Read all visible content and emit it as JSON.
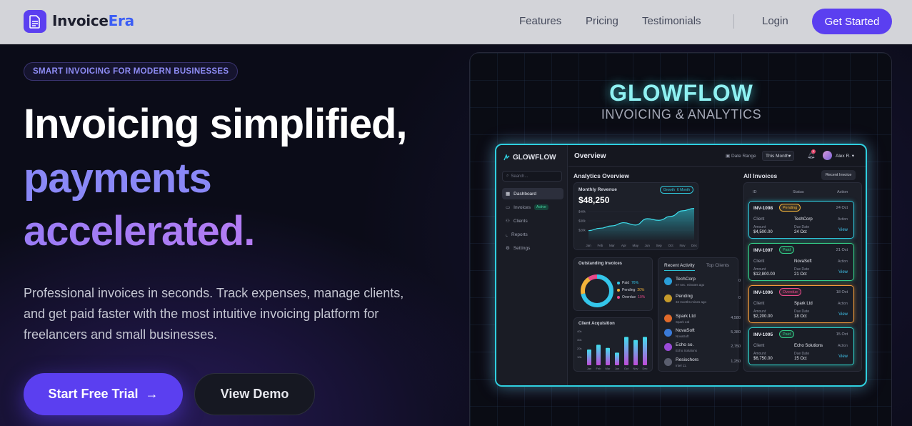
{
  "nav": {
    "brand_main": "Invoice",
    "brand_accent": "Era",
    "links": [
      "Features",
      "Pricing",
      "Testimonials"
    ],
    "login": "Login",
    "cta": "Get Started"
  },
  "hero": {
    "badge": "SMART INVOICING FOR MODERN BUSINESSES",
    "line1": "Invoicing simplified,",
    "line2": "payments",
    "line3": "accelerated.",
    "description": "Professional invoices in seconds. Track expenses, manage clients, and get paid faster with the most intuitive invoicing platform for freelancers and small businesses.",
    "primary_cta": "Start Free Trial",
    "primary_arrow": "→",
    "secondary_cta": "View Demo"
  },
  "showcase": {
    "title": "GLOWFLOW",
    "subtitle": "INVOICING & ANALYTICS",
    "dashboard": {
      "logo": "GLOWFLOW",
      "search_placeholder": "Search...",
      "sidebar": [
        "Dashboard",
        "Invoices",
        "Clients",
        "Reports",
        "Settings"
      ],
      "invoices_badge": "Active",
      "page_title": "Overview",
      "date_range_label": "Date Range",
      "date_range_value": "This Month",
      "notif_count": "3",
      "user_name": "Alex R.",
      "analytics_title": "Analytics Overview",
      "revenue": {
        "label": "Monthly Revenue",
        "value": "$48,250",
        "growth_label": "Growth",
        "period": "6 Month",
        "y_ticks": [
          "$40k",
          "$30k",
          "$20k"
        ],
        "months": [
          "Jan",
          "Feb",
          "Mar",
          "Apr",
          "May",
          "Jun",
          "Sep",
          "Oct",
          "Nov",
          "Dec"
        ],
        "values": [
          12,
          15,
          18,
          22,
          19,
          27,
          25,
          30,
          37,
          40
        ]
      },
      "outstanding": {
        "label": "Outstanding Invoices",
        "legend": [
          {
            "name": "Paid",
            "pct": "76%",
            "value": 76,
            "color": "#34c6ea"
          },
          {
            "name": "Pending",
            "pct": "20%",
            "value": 20,
            "color": "#f2b33a"
          },
          {
            "name": "Overdue",
            "pct": "10%",
            "value": 10,
            "color": "#e84a8a"
          }
        ]
      },
      "acquisition": {
        "label": "Client Acquisition",
        "y_ticks": [
          "40k",
          "30k",
          "20k",
          "10k"
        ],
        "months": [
          "Jan",
          "Feb",
          "Mar",
          "Jun",
          "Oct",
          "Nov",
          "Dec"
        ],
        "values": [
          20,
          26,
          22,
          16,
          36,
          32,
          36
        ]
      },
      "activity_tabs": [
        "Recent Activity",
        "Top Clients"
      ],
      "activity": [
        {
          "name": "TechCorp",
          "sub": "67 sec. minutes ago",
          "value": "0",
          "color": "#2a9ed8"
        },
        {
          "name": "Pending",
          "sub": "32 months mines ago",
          "value": "0",
          "color": "#c59a2a"
        },
        {
          "name": "Spark Ltd",
          "sub": "Spark Ltd",
          "value": "4,580",
          "color": "#e06a2a"
        },
        {
          "name": "NovaSoft",
          "sub": "NovaSoft",
          "value": "5,380",
          "color": "#3a7ad8"
        },
        {
          "name": "Echo so.",
          "sub": "Echo Solutions",
          "value": "2,750",
          "color": "#9a4ad8"
        },
        {
          "name": "Resischors",
          "sub": "Intel 11.",
          "value": "1,250",
          "color": "#5a5e6e"
        }
      ],
      "all_invoices_title": "All Invoices",
      "recent_btn": "Recent Invoice",
      "table_headers": [
        "ID",
        "Status",
        "Action"
      ],
      "client_label": "Client",
      "amount_label": "Amount",
      "due_label": "Due Date",
      "action_label": "Action",
      "view_label": "View",
      "invoices": [
        {
          "id": "INV-1098",
          "status": "Pending",
          "date": "24 Oct",
          "client": "TechCorp",
          "amount": "$4,500.00",
          "due": "24 Oct",
          "color": "#f2b33a",
          "border": "#2fc5d8"
        },
        {
          "id": "INV-1097",
          "status": "Paid",
          "date": "21 Oct",
          "client": "NovaSoft",
          "amount": "$12,800.00",
          "due": "21 Oct",
          "color": "#34d08a",
          "border": "#34d08a"
        },
        {
          "id": "INV-1096",
          "status": "Overdue",
          "date": "18 Oct",
          "client": "Spark Ltd",
          "amount": "$2,200.00",
          "due": "18 Oct",
          "color": "#e84a8a",
          "border": "#f29a3a"
        },
        {
          "id": "INV-1095",
          "status": "Paid",
          "date": "15 Oct",
          "client": "Echo Solutions",
          "amount": "$6,750.00",
          "due": "15 Oct",
          "color": "#34d08a",
          "border": "#2fd0c8"
        }
      ]
    }
  }
}
